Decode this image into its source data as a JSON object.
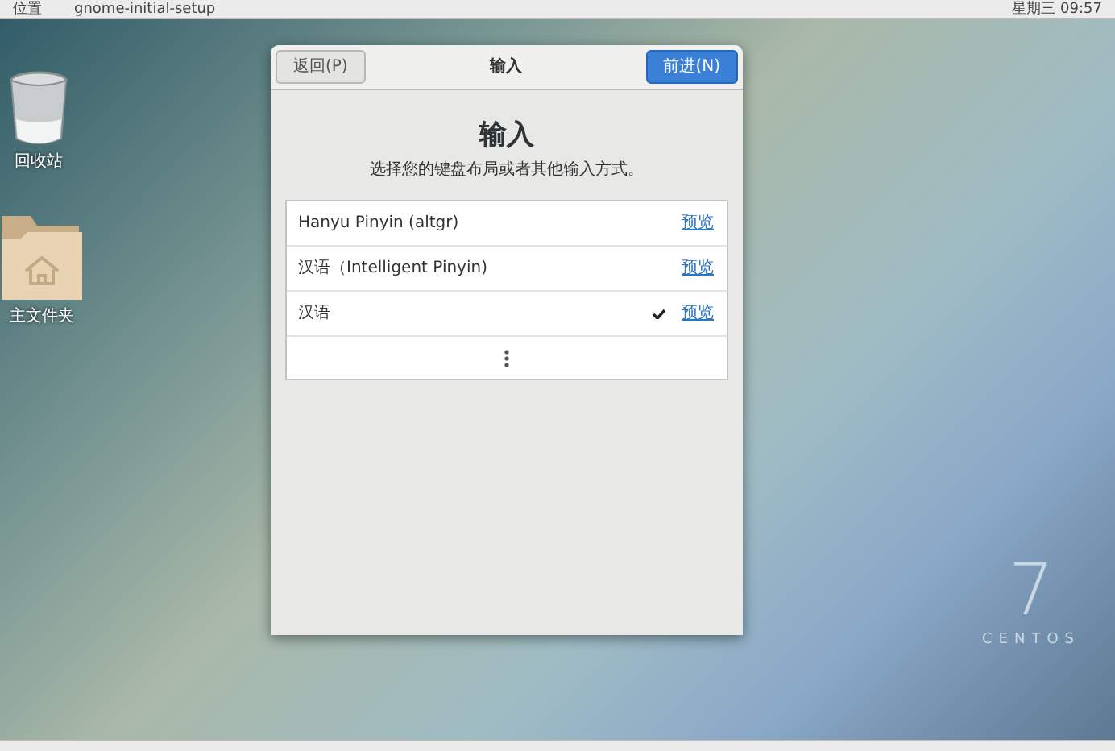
{
  "top_bar": {
    "menu": "位置",
    "app": "gnome-initial-setup",
    "clock": "星期三 09:57"
  },
  "desktop_icons": [
    {
      "label": "回收站",
      "kind": "trash"
    },
    {
      "label": "主文件夹",
      "kind": "home_folder"
    }
  ],
  "dialog": {
    "back_button": "返回(P)",
    "title": "输入",
    "next_button": "前进(N)",
    "heading": "输入",
    "subtitle": "选择您的键盘布局或者其他输入方式。",
    "input_sources": [
      {
        "name": "Hanyu Pinyin (altgr)",
        "selected": false,
        "preview": "预览"
      },
      {
        "name": "汉语（Intelligent Pinyin)",
        "selected": false,
        "preview": "预览"
      },
      {
        "name": "汉语",
        "selected": true,
        "preview": "预览"
      }
    ]
  },
  "branding": {
    "number": "7",
    "name": "CENTOS"
  }
}
